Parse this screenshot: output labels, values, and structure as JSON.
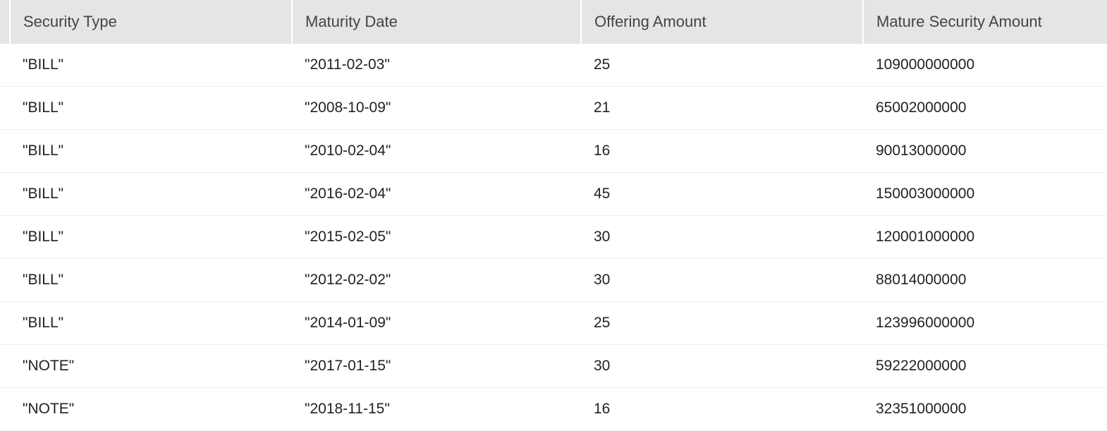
{
  "table": {
    "columns": [
      "Security Type",
      "Maturity Date",
      "Offering Amount",
      "Mature Security Amount"
    ],
    "rows": [
      {
        "security_type": "\"BILL\"",
        "maturity_date": "\"2011-02-03\"",
        "offering_amount": "25",
        "mature_security_amount": "109000000000"
      },
      {
        "security_type": "\"BILL\"",
        "maturity_date": "\"2008-10-09\"",
        "offering_amount": "21",
        "mature_security_amount": "65002000000"
      },
      {
        "security_type": "\"BILL\"",
        "maturity_date": "\"2010-02-04\"",
        "offering_amount": "16",
        "mature_security_amount": "90013000000"
      },
      {
        "security_type": "\"BILL\"",
        "maturity_date": "\"2016-02-04\"",
        "offering_amount": "45",
        "mature_security_amount": "150003000000"
      },
      {
        "security_type": "\"BILL\"",
        "maturity_date": "\"2015-02-05\"",
        "offering_amount": "30",
        "mature_security_amount": "120001000000"
      },
      {
        "security_type": "\"BILL\"",
        "maturity_date": "\"2012-02-02\"",
        "offering_amount": "30",
        "mature_security_amount": "88014000000"
      },
      {
        "security_type": "\"BILL\"",
        "maturity_date": "\"2014-01-09\"",
        "offering_amount": "25",
        "mature_security_amount": "123996000000"
      },
      {
        "security_type": "\"NOTE\"",
        "maturity_date": "\"2017-01-15\"",
        "offering_amount": "30",
        "mature_security_amount": "59222000000"
      },
      {
        "security_type": "\"NOTE\"",
        "maturity_date": "\"2018-11-15\"",
        "offering_amount": "16",
        "mature_security_amount": "32351000000"
      }
    ]
  }
}
